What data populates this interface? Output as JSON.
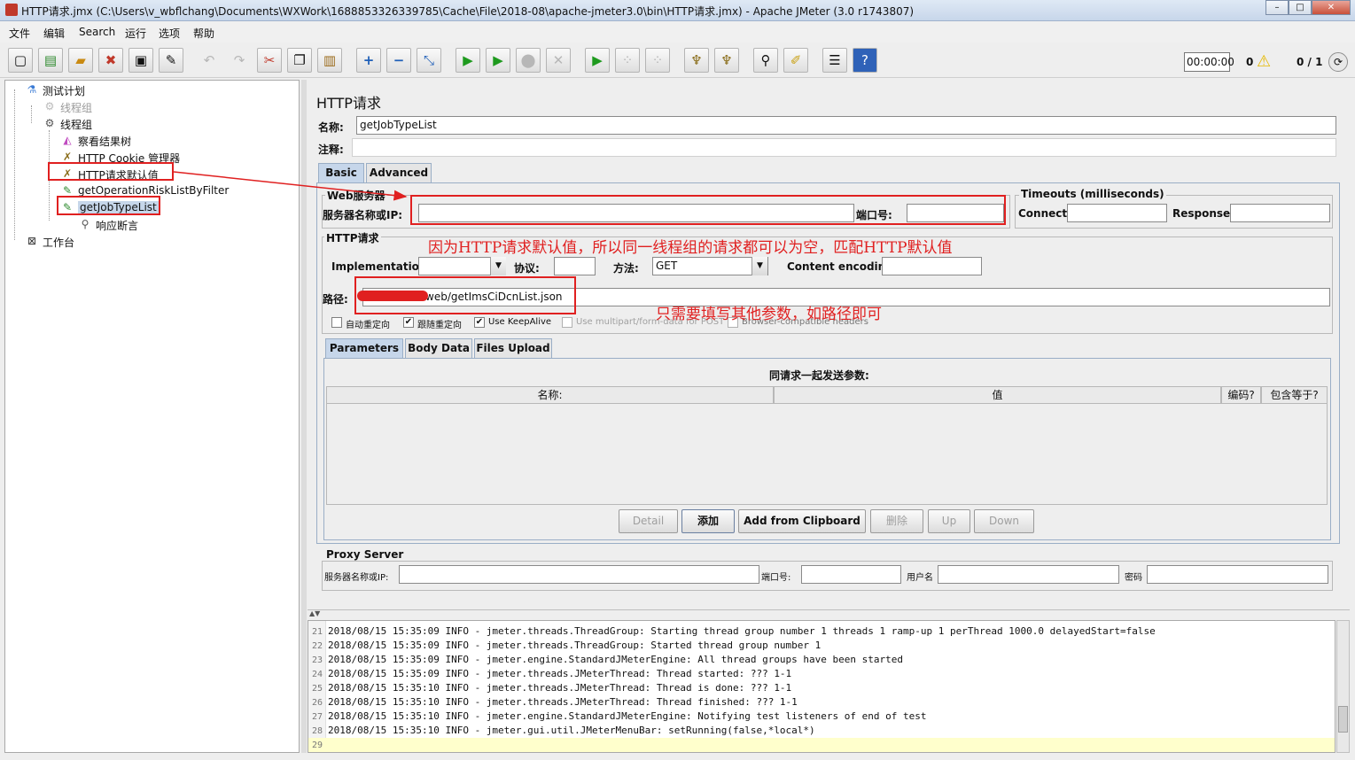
{
  "window": {
    "title": "HTTP请求.jmx (C:\\Users\\v_wbflchang\\Documents\\WXWork\\1688853326339785\\Cache\\File\\2018-08\\apache-jmeter3.0\\bin\\HTTP请求.jmx) - Apache JMeter (3.0 r1743807)",
    "min": "–",
    "max": "□",
    "close": "✕"
  },
  "menu": [
    "文件",
    "编辑",
    "Search",
    "运行",
    "选项",
    "帮助"
  ],
  "status": {
    "timer": "00:00:00",
    "warnings": "0",
    "threads": "0 / 1"
  },
  "tree": {
    "items": [
      {
        "label": "测试计划",
        "icon": "flask-icon"
      },
      {
        "label": "线程组",
        "icon": "gear-icon"
      },
      {
        "label": "线程组",
        "icon": "gear-icon"
      },
      {
        "label": "察看结果树",
        "icon": "chart-icon"
      },
      {
        "label": "HTTP Cookie 管理器",
        "icon": "wrench-icon"
      },
      {
        "label": "HTTP请求默认值",
        "icon": "wrench-icon"
      },
      {
        "label": "getOperationRiskListByFilter",
        "icon": "pipette-icon"
      },
      {
        "label": "getJobTypeList",
        "icon": "pipette-icon"
      },
      {
        "label": "响应断言",
        "icon": "magnifier-icon"
      },
      {
        "label": "工作台",
        "icon": "workbench-icon"
      }
    ]
  },
  "sampler": {
    "heading": "HTTP请求",
    "name_label": "名称:",
    "name_value": "getJobTypeList",
    "comment_label": "注释:",
    "comment_value": "",
    "tabs": [
      "Basic",
      "Advanced"
    ],
    "web_server": {
      "title": "Web服务器",
      "server_label": "服务器名称或IP:",
      "server_value": "",
      "port_label": "端口号:",
      "port_value": ""
    },
    "timeouts": {
      "title": "Timeouts (milliseconds)",
      "connect_label": "Connect:",
      "connect_value": "",
      "response_label": "Response:",
      "response_value": ""
    },
    "http_request": {
      "title": "HTTP请求",
      "implementation_label": "Implementation:",
      "implementation_value": "",
      "protocol_label": "协议:",
      "protocol_value": "",
      "method_label": "方法:",
      "method_value": "GET",
      "encoding_label": "Content encoding:",
      "encoding_value": "",
      "path_label": "路径:",
      "path_value": "web/getImsCiDcnList.json"
    },
    "checkboxes": [
      {
        "label": "自动重定向",
        "checked": false
      },
      {
        "label": "跟随重定向",
        "checked": true
      },
      {
        "label": "Use KeepAlive",
        "checked": true
      },
      {
        "label": "Use multipart/form-data for POST",
        "checked": false
      },
      {
        "label": "Browser-compatible headers",
        "checked": false
      }
    ],
    "param_tabs": [
      "Parameters",
      "Body Data",
      "Files Upload"
    ],
    "params": {
      "caption": "同请求一起发送参数:",
      "columns": [
        "名称:",
        "值",
        "编码?",
        "包含等于?"
      ]
    },
    "buttons": {
      "detail": "Detail",
      "add": "添加",
      "clipboard": "Add from Clipboard",
      "delete": "删除",
      "up": "Up",
      "down": "Down"
    },
    "proxy": {
      "title": "Proxy Server",
      "server_label": "服务器名称或IP:",
      "port_label": "端口号:",
      "user_label": "用户名",
      "password_label": "密码"
    }
  },
  "annotations": {
    "note1": "因为HTTP请求默认值，所以同一线程组的请求都可以为空，匹配HTTP默认值",
    "note2": "只需要填写其他参数，如路径即可"
  },
  "log": [
    {
      "n": "21",
      "text": "2018/08/15 15:35:09 INFO  - jmeter.threads.ThreadGroup: Starting thread group number 1 threads 1 ramp-up 1 perThread 1000.0 delayedStart=false"
    },
    {
      "n": "22",
      "text": "2018/08/15 15:35:09 INFO  - jmeter.threads.ThreadGroup: Started thread group number 1"
    },
    {
      "n": "23",
      "text": "2018/08/15 15:35:09 INFO  - jmeter.engine.StandardJMeterEngine: All thread groups have been started"
    },
    {
      "n": "24",
      "text": "2018/08/15 15:35:09 INFO  - jmeter.threads.JMeterThread: Thread started: ??? 1-1"
    },
    {
      "n": "25",
      "text": "2018/08/15 15:35:10 INFO  - jmeter.threads.JMeterThread: Thread is done: ??? 1-1"
    },
    {
      "n": "26",
      "text": "2018/08/15 15:35:10 INFO  - jmeter.threads.JMeterThread: Thread finished: ??? 1-1"
    },
    {
      "n": "27",
      "text": "2018/08/15 15:35:10 INFO  - jmeter.engine.StandardJMeterEngine: Notifying test listeners of end of test"
    },
    {
      "n": "28",
      "text": "2018/08/15 15:35:10 INFO  - jmeter.gui.util.JMeterMenuBar: setRunning(false,*local*)"
    },
    {
      "n": "29",
      "text": ""
    }
  ],
  "colors": {
    "annotation": "#e02020",
    "selection": "#c6d6ea",
    "log_highlight": "#ffffcc"
  }
}
